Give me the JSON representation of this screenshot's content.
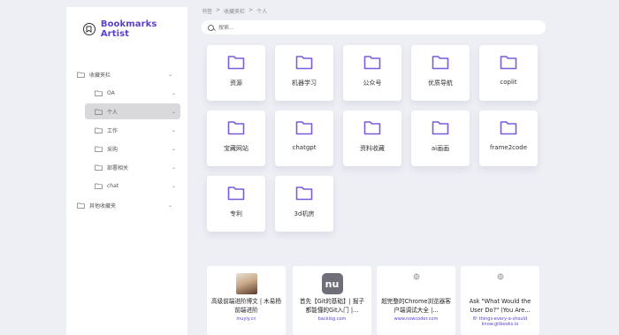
{
  "app": {
    "title": "Bookmarks Artist"
  },
  "breadcrumb": [
    "书签",
    "收藏夹栏",
    "个人"
  ],
  "search": {
    "placeholder": "搜索..."
  },
  "sidebar": {
    "items": [
      {
        "label": "收藏夹栏",
        "level": 0,
        "expanded": true
      },
      {
        "label": "OA",
        "level": 1
      },
      {
        "label": "个人",
        "level": 1,
        "active": true
      },
      {
        "label": "工作",
        "level": 1
      },
      {
        "label": "采购",
        "level": 1
      },
      {
        "label": "部署相关",
        "level": 1
      },
      {
        "label": "chat",
        "level": 1
      },
      {
        "label": "其他收藏夹",
        "level": 0
      }
    ]
  },
  "folders": [
    {
      "label": "资源"
    },
    {
      "label": "机器学习"
    },
    {
      "label": "公众号"
    },
    {
      "label": "优质导航"
    },
    {
      "label": "coplit"
    },
    {
      "label": "宝藏网站"
    },
    {
      "label": "chatgpt"
    },
    {
      "label": "资料收藏"
    },
    {
      "label": "ai画画"
    },
    {
      "label": "frame2code"
    },
    {
      "label": "专利"
    },
    {
      "label": "3d机房"
    }
  ],
  "links": [
    {
      "title": "高级前端进阶博文 | 木易杨前端进阶",
      "url": "muyiy.cn",
      "icon": "avatar-photo"
    },
    {
      "title": "首先【Git的基础】| 掘子都能懂的Git入门 |...",
      "url": "backlog.com",
      "icon": "nu-logo",
      "icon_text": "nu"
    },
    {
      "title": "超完整的Chrome浏览器客户端调试大全 |...",
      "url": "www.nowcoder.com",
      "icon": "globe-icon"
    },
    {
      "title": "Ask \"What Would the User Do?\" (You Are...",
      "url": "8! things-every-a-should know.gitbooks.io",
      "icon": "globe-icon"
    }
  ],
  "colors": {
    "accent": "#5b3fcf",
    "folder": "#7c5cdc"
  }
}
